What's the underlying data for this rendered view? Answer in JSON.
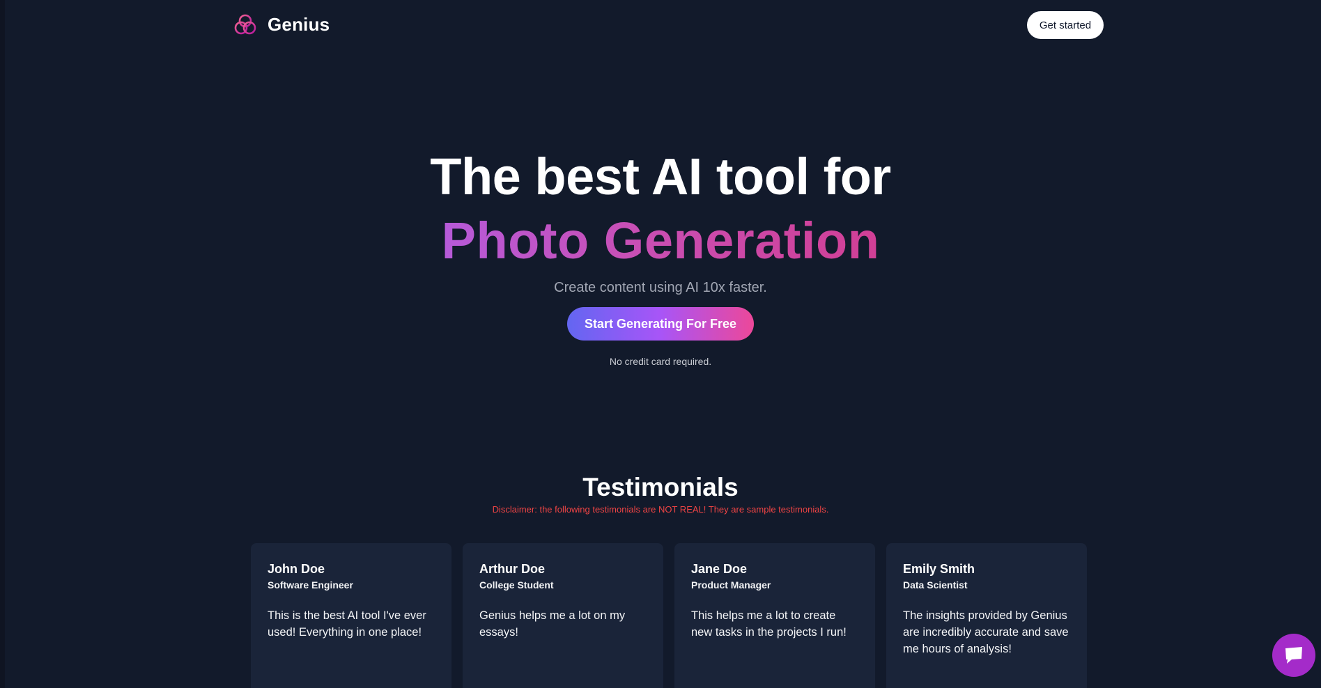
{
  "brand": {
    "name": "Genius"
  },
  "nav": {
    "get_started_label": "Get started"
  },
  "hero": {
    "line1": "The best AI tool for",
    "line2": "Photo Generation",
    "subtitle": "Create content using AI 10x faster.",
    "cta_label": "Start Generating For Free",
    "note": "No credit card required."
  },
  "testimonials": {
    "title": "Testimonials",
    "disclaimer": "Disclaimer: the following testimonials are NOT REAL! They are sample testimonials.",
    "items": [
      {
        "name": "John Doe",
        "role": "Software Engineer",
        "text": "This is the best AI tool I've ever used! Everything in one place!"
      },
      {
        "name": "Arthur Doe",
        "role": "College Student",
        "text": "Genius helps me a lot on my essays!"
      },
      {
        "name": "Jane Doe",
        "role": "Product Manager",
        "text": "This helps me a lot to create new tasks in the projects I run!"
      },
      {
        "name": "Emily Smith",
        "role": "Data Scientist",
        "text": "The insights provided by Genius are incredibly accurate and save me hours of analysis!"
      }
    ]
  },
  "icons": {
    "logo": "genius-logo-icon",
    "chat": "chat-icon"
  },
  "colors": {
    "background": "#121a2b",
    "card": "#1a2439",
    "gradient_start": "#6366f1",
    "gradient_end": "#ec4899",
    "disclaimer": "#ef4444",
    "chat_button": "#a42bc9"
  }
}
